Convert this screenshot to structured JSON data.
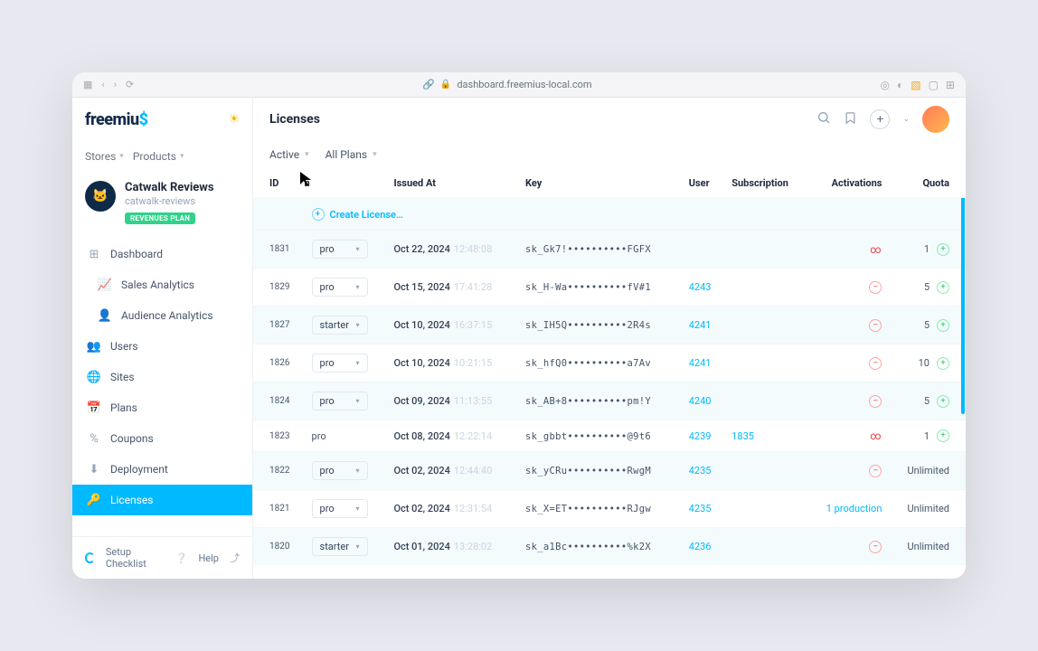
{
  "browser": {
    "url": "dashboard.freemius-local.com"
  },
  "logo": {
    "text_a": "freemiu",
    "text_b": "$"
  },
  "page_title": "Licenses",
  "crumbs": {
    "stores": "Stores",
    "products": "Products"
  },
  "store": {
    "name": "Catwalk Reviews",
    "slug": "catwalk-reviews",
    "plan": "REVENUES PLAN"
  },
  "nav": [
    {
      "icon": "⊞",
      "label": "Dashboard",
      "sub": false,
      "active": false
    },
    {
      "icon": "📈",
      "label": "Sales Analytics",
      "sub": true,
      "active": false
    },
    {
      "icon": "👤",
      "label": "Audience Analytics",
      "sub": true,
      "active": false
    },
    {
      "icon": "👥",
      "label": "Users",
      "sub": false,
      "active": false
    },
    {
      "icon": "🌐",
      "label": "Sites",
      "sub": false,
      "active": false
    },
    {
      "icon": "📅",
      "label": "Plans",
      "sub": false,
      "active": false
    },
    {
      "icon": "%",
      "label": "Coupons",
      "sub": false,
      "active": false
    },
    {
      "icon": "⬇",
      "label": "Deployment",
      "sub": false,
      "active": false
    },
    {
      "icon": "🔑",
      "label": "Licenses",
      "sub": false,
      "active": true
    }
  ],
  "footer": {
    "setup": "Setup Checklist",
    "help": "Help"
  },
  "filters": {
    "status": "Active",
    "plans": "All Plans"
  },
  "columns": {
    "id": "ID",
    "plan": "n",
    "issued": "Issued At",
    "key": "Key",
    "user": "User",
    "sub": "Subscription",
    "act": "Activations",
    "quota": "Quota"
  },
  "create": "Create License…",
  "rows": [
    {
      "id": "1831",
      "plan": "pro",
      "dd": true,
      "date": "Oct 22, 2024",
      "time": "12:48:08",
      "key": "sk_Gk7!••••••••••FGFX",
      "user": "",
      "sub": "",
      "act_icon": "inf",
      "act": "",
      "quota": "1",
      "plus": true,
      "alt": true
    },
    {
      "id": "1829",
      "plan": "pro",
      "dd": true,
      "date": "Oct 15, 2024",
      "time": "17:41:28",
      "key": "sk_H-Wa••••••••••fV#1",
      "user": "4243",
      "sub": "",
      "act_icon": "minus",
      "act": "",
      "quota": "5",
      "plus": true,
      "alt": false
    },
    {
      "id": "1827",
      "plan": "starter",
      "dd": true,
      "date": "Oct 10, 2024",
      "time": "16:37:15",
      "key": "sk_IH5Q••••••••••2R4s",
      "user": "4241",
      "sub": "",
      "act_icon": "minus",
      "act": "",
      "quota": "5",
      "plus": true,
      "alt": true
    },
    {
      "id": "1826",
      "plan": "pro",
      "dd": true,
      "date": "Oct 10, 2024",
      "time": "10:21:15",
      "key": "sk_hfQ0••••••••••a7Av",
      "user": "4241",
      "sub": "",
      "act_icon": "minus",
      "act": "",
      "quota": "10",
      "plus": true,
      "alt": false
    },
    {
      "id": "1824",
      "plan": "pro",
      "dd": true,
      "date": "Oct 09, 2024",
      "time": "11:13:55",
      "key": "sk_AB+8••••••••••pm!Y",
      "user": "4240",
      "sub": "",
      "act_icon": "minus",
      "act": "",
      "quota": "5",
      "plus": true,
      "alt": true
    },
    {
      "id": "1823",
      "plan": "pro",
      "dd": false,
      "date": "Oct 08, 2024",
      "time": "12:22:14",
      "key": "sk_gbbt••••••••••@9t6",
      "user": "4239",
      "sub": "1835",
      "act_icon": "inf2",
      "act": "",
      "quota": "1",
      "plus": true,
      "alt": false
    },
    {
      "id": "1822",
      "plan": "pro",
      "dd": true,
      "date": "Oct 02, 2024",
      "time": "12:44:40",
      "key": "sk_yCRu••••••••••RwgM",
      "user": "4235",
      "sub": "",
      "act_icon": "minus",
      "act": "",
      "quota": "Unlimited",
      "plus": false,
      "alt": true
    },
    {
      "id": "1821",
      "plan": "pro",
      "dd": true,
      "date": "Oct 02, 2024",
      "time": "12:31:54",
      "key": "sk_X=ET••••••••••RJgw",
      "user": "4235",
      "sub": "",
      "act_icon": "none",
      "act": "1 production",
      "quota": "Unlimited",
      "plus": false,
      "alt": false
    },
    {
      "id": "1820",
      "plan": "starter",
      "dd": true,
      "date": "Oct 01, 2024",
      "time": "13:28:02",
      "key": "sk_a1Bc••••••••••%k2X",
      "user": "4236",
      "sub": "",
      "act_icon": "minus",
      "act": "",
      "quota": "Unlimited",
      "plus": false,
      "alt": true
    }
  ]
}
